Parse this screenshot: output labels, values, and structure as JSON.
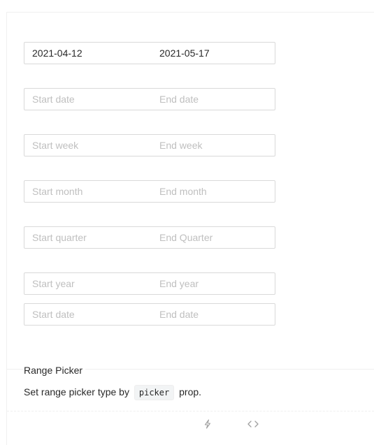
{
  "pickers": [
    {
      "start": "2021-04-12",
      "end": "2021-05-17",
      "start_is_placeholder": false,
      "end_is_placeholder": false
    },
    {
      "start": "Start date",
      "end": "End date",
      "start_is_placeholder": true,
      "end_is_placeholder": true
    },
    {
      "start": "Start week",
      "end": "End week",
      "start_is_placeholder": true,
      "end_is_placeholder": true
    },
    {
      "start": "Start month",
      "end": "End month",
      "start_is_placeholder": true,
      "end_is_placeholder": true
    },
    {
      "start": "Start quarter",
      "end": "End Quarter",
      "start_is_placeholder": true,
      "end_is_placeholder": true
    },
    {
      "start": "Start year",
      "end": "End year",
      "start_is_placeholder": true,
      "end_is_placeholder": true
    },
    {
      "start": "Start date",
      "end": "End date",
      "start_is_placeholder": true,
      "end_is_placeholder": true
    }
  ],
  "meta": {
    "title": "Range Picker",
    "desc_before": "Set range picker type by",
    "desc_code": "picker",
    "desc_after": "prop."
  },
  "actions": {
    "codesandbox_icon": "lightning-icon",
    "code_icon": "code-icon"
  },
  "colors": {
    "border": "#d9d9d9",
    "placeholder": "#bfbfbf",
    "text": "rgba(0,0,0,0.85)",
    "divider": "#f0f0f0"
  }
}
